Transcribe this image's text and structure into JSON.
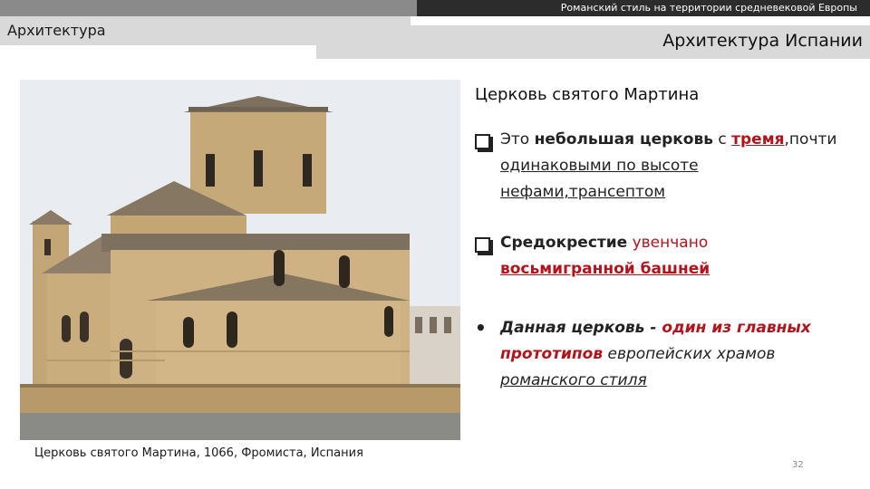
{
  "header": {
    "subtitle": "Романский стиль на территории средневековой Европы",
    "section": "Архитектура",
    "topic": "Архитектура Испании"
  },
  "photo": {
    "caption": "Церковь святого Мартина, 1066, Фромиста, Испания"
  },
  "content": {
    "heading": "Церковь святого Мартина",
    "bullet1": {
      "p1": "Это ",
      "p2": "небольшая церковь",
      "p3": " с ",
      "p4": "тремя",
      "p5": ",почти ",
      "p6": "одинаковыми по высоте нефами,трансептом"
    },
    "bullet2": {
      "p1": "Средокрестие",
      "p2": " увенчано ",
      "p3": "восьмигранной башней"
    },
    "bullet3": {
      "p1": "Данная церковь - ",
      "p2": "один из главных прототипов",
      "p3": " европейских храмов ",
      "p4": "романского стиля"
    }
  },
  "footer": {
    "page_number": "32"
  },
  "colors": {
    "accent_red": "#b3141c",
    "band_gray": "#d9d9d9",
    "strip_dark": "#2c2c2c",
    "stone": "#c9ad7c"
  },
  "icons": {
    "bullet_marker": "checkbox-bullet-icon",
    "dot_marker": "round-bullet-icon"
  }
}
